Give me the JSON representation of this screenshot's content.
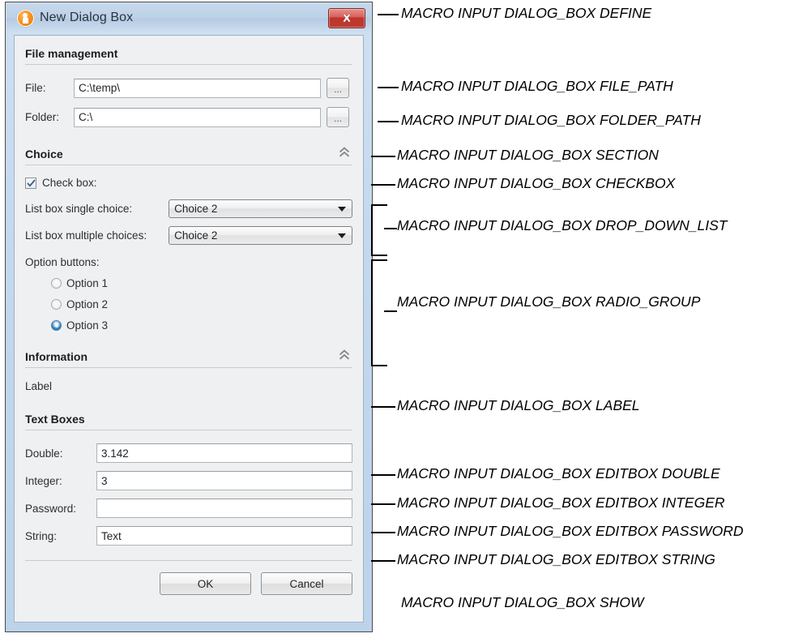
{
  "window": {
    "title": "New Dialog Box",
    "icon": "person-circle-icon",
    "close_label": "×",
    "accent_orange": "#f58a16",
    "close_red": "#c0342c",
    "titlebar_blue": "#bed2e8",
    "body_gray": "#eff0f1"
  },
  "sections": {
    "file_management": {
      "title": "File management",
      "collapsible": false,
      "fields": [
        {
          "label": "File:",
          "value": "C:\\temp\\",
          "browse": "..."
        },
        {
          "label": "Folder:",
          "value": "C:\\",
          "browse": "..."
        }
      ]
    },
    "choice": {
      "title": "Choice",
      "collapsible": true,
      "checkbox": {
        "label": "Check box:",
        "checked": true
      },
      "dropdowns": [
        {
          "label": "List box single choice:",
          "value": "Choice 2"
        },
        {
          "label": "List box multiple choices:",
          "value": "Choice 2"
        }
      ],
      "option_group_label": "Option buttons:",
      "options": [
        {
          "label": "Option 1",
          "selected": false
        },
        {
          "label": "Option 2",
          "selected": false
        },
        {
          "label": "Option 3",
          "selected": true
        }
      ]
    },
    "information": {
      "title": "Information",
      "collapsible": true,
      "label_text": "Label"
    },
    "text_boxes": {
      "title": "Text Boxes",
      "collapsible": false,
      "fields": [
        {
          "label": "Double:",
          "value": "3.142"
        },
        {
          "label": "Integer:",
          "value": "3"
        },
        {
          "label": "Password:",
          "value": ""
        },
        {
          "label": "String:",
          "value": "Text"
        }
      ]
    }
  },
  "footer": {
    "ok_label": "OK",
    "cancel_label": "Cancel"
  },
  "annotations": [
    {
      "id": "define",
      "text": "MACRO INPUT DIALOG_BOX DEFINE"
    },
    {
      "id": "file_path",
      "text": "MACRO INPUT DIALOG_BOX FILE_PATH"
    },
    {
      "id": "folder_path",
      "text": "MACRO INPUT DIALOG_BOX FOLDER_PATH"
    },
    {
      "id": "section",
      "text": "MACRO INPUT DIALOG_BOX SECTION"
    },
    {
      "id": "checkbox",
      "text": "MACRO INPUT DIALOG_BOX CHECKBOX"
    },
    {
      "id": "drop_down",
      "text": "MACRO INPUT DIALOG_BOX DROP_DOWN_LIST"
    },
    {
      "id": "radio_group",
      "text": "MACRO INPUT DIALOG_BOX RADIO_GROUP"
    },
    {
      "id": "label",
      "text": "MACRO INPUT DIALOG_BOX LABEL"
    },
    {
      "id": "editbox_double",
      "text": "MACRO INPUT DIALOG_BOX EDITBOX DOUBLE"
    },
    {
      "id": "editbox_int",
      "text": "MACRO INPUT DIALOG_BOX EDITBOX INTEGER"
    },
    {
      "id": "editbox_pass",
      "text": "MACRO INPUT DIALOG_BOX EDITBOX PASSWORD"
    },
    {
      "id": "editbox_str",
      "text": "MACRO INPUT DIALOG_BOX EDITBOX STRING"
    },
    {
      "id": "show",
      "text": "MACRO INPUT DIALOG_BOX SHOW"
    }
  ]
}
